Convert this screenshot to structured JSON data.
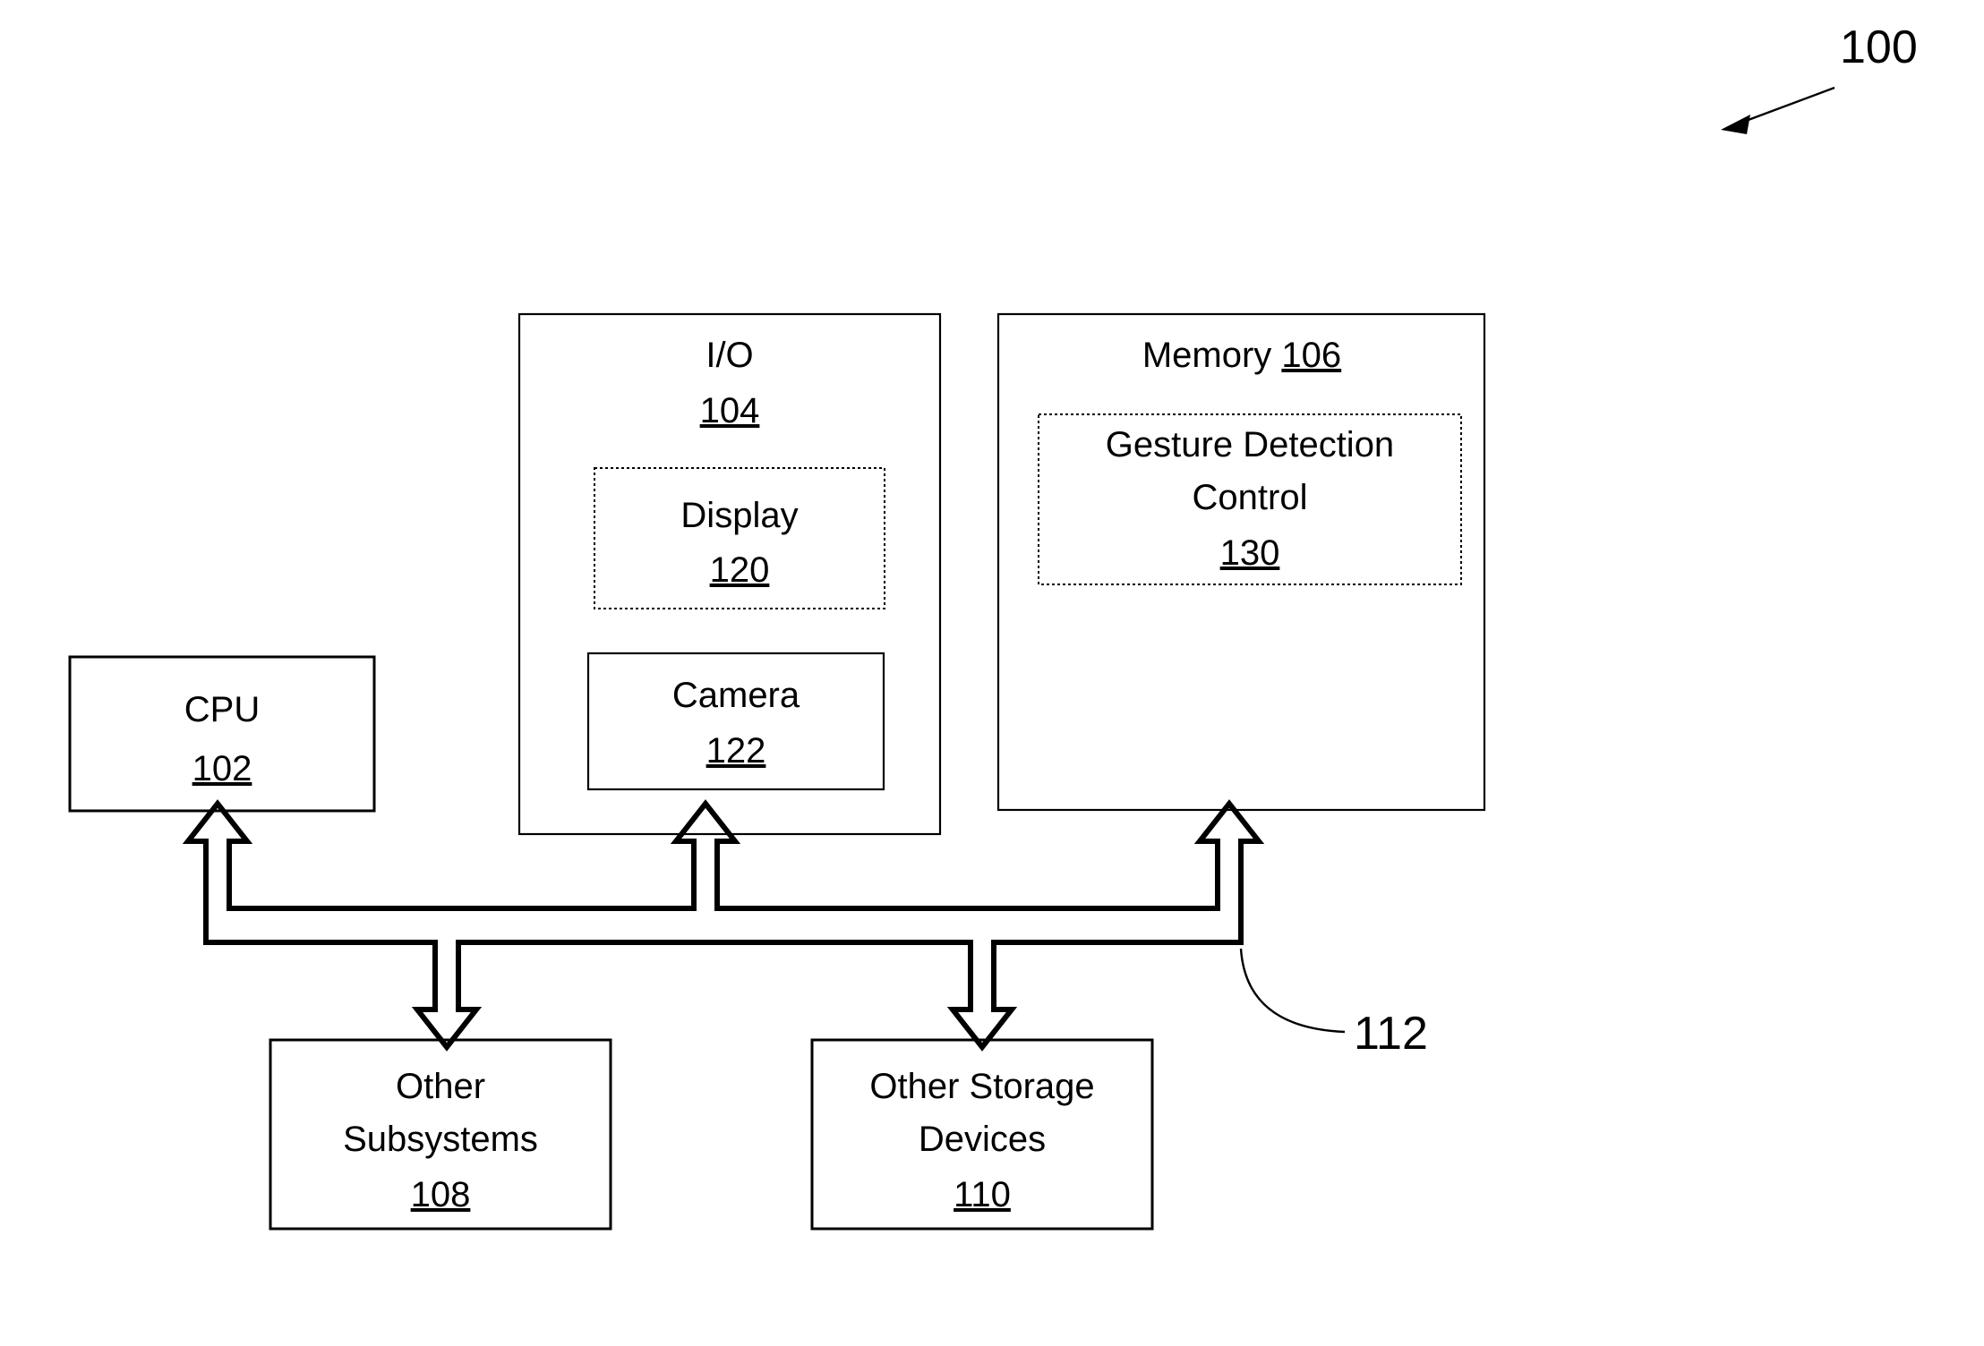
{
  "figure": {
    "number": "100",
    "bus_reference": "112"
  },
  "blocks": {
    "cpu": {
      "label": "CPU",
      "ref": "102"
    },
    "io": {
      "label": "I/O",
      "ref": "104",
      "children": {
        "display": {
          "label": "Display",
          "ref": "120"
        },
        "camera": {
          "label": "Camera",
          "ref": "122"
        }
      }
    },
    "memory": {
      "label": "Memory",
      "ref": "106",
      "children": {
        "gesture_detection_control": {
          "label_line1": "Gesture Detection",
          "label_line2": "Control",
          "ref": "130"
        }
      }
    },
    "other_subsystems": {
      "label_line1": "Other",
      "label_line2": "Subsystems",
      "ref": "108"
    },
    "other_storage_devices": {
      "label_line1": "Other Storage",
      "label_line2": "Devices",
      "ref": "110"
    }
  },
  "colors": {
    "stroke": "#000000",
    "background": "#ffffff",
    "text": "#000000"
  }
}
